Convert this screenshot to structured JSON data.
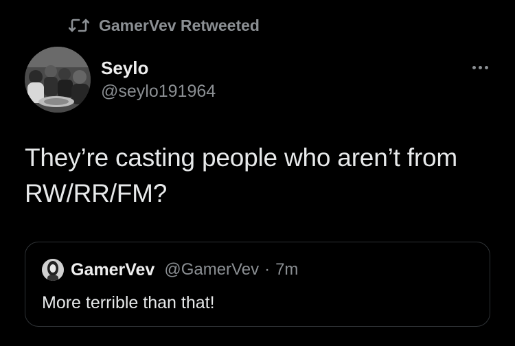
{
  "retweet_header": {
    "icon": "retweet-icon",
    "text": "GamerVev Retweeted"
  },
  "tweet": {
    "avatar_icon": "user-avatar",
    "display_name": "Seylo",
    "handle": "@seylo191964",
    "text": "They’re casting people who aren’t from RW/RR/FM?",
    "more_icon": "more-options-icon"
  },
  "quoted_tweet": {
    "avatar_icon": "quoted-user-avatar",
    "display_name": "GamerVev",
    "handle": "@GamerVev",
    "separator": "·",
    "time": "7m",
    "text": "More terrible than that!"
  },
  "colors": {
    "background": "#000000",
    "primary_text": "#e7e9ea",
    "secondary_text": "#8b8f93",
    "border": "#2f3336"
  }
}
